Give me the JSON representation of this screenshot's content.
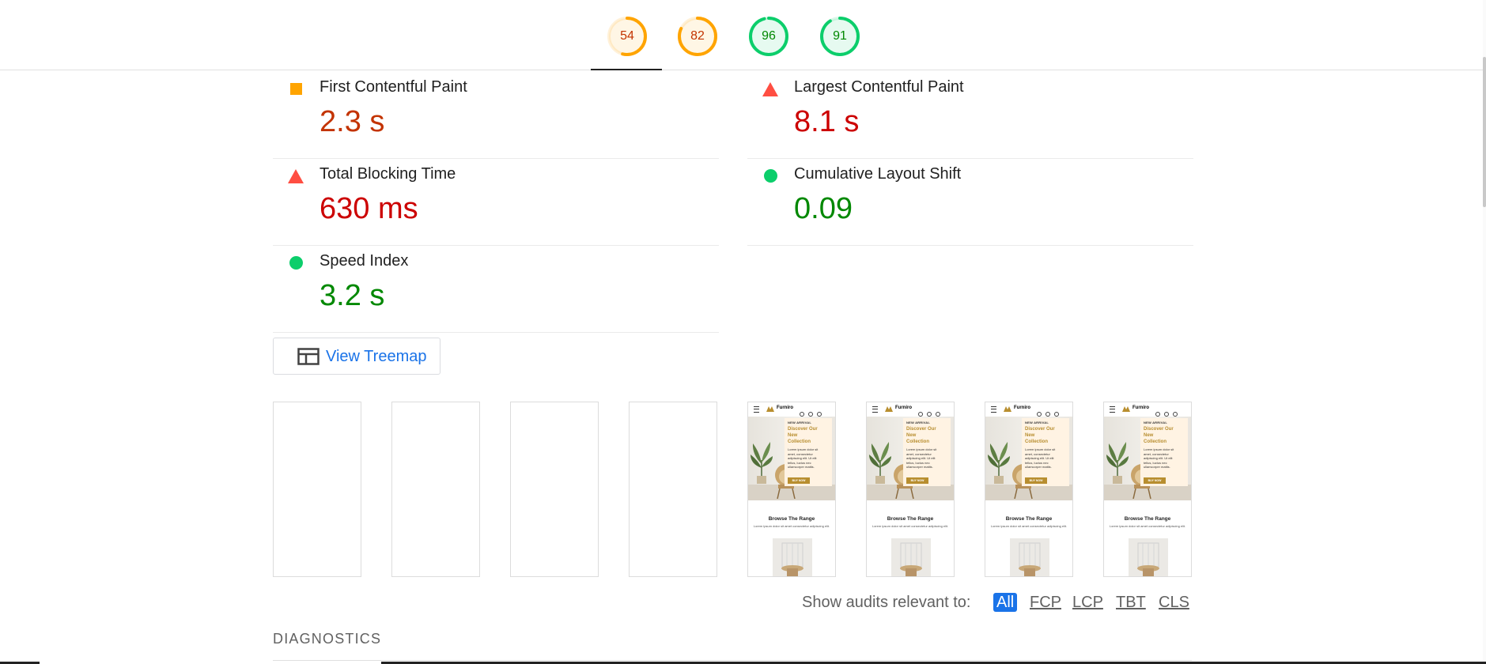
{
  "gauges": [
    {
      "score": "54",
      "fraction": 0.54,
      "color": "#ffa400",
      "text_color": "#c33300"
    },
    {
      "score": "82",
      "fraction": 0.82,
      "color": "#ffa400",
      "text_color": "#c33300"
    },
    {
      "score": "96",
      "fraction": 0.96,
      "color": "#0cce6b",
      "text_color": "#008800"
    },
    {
      "score": "91",
      "fraction": 0.91,
      "color": "#0cce6b",
      "text_color": "#008800"
    }
  ],
  "metrics": [
    {
      "title": "First Contentful Paint",
      "value": "2.3 s",
      "status": "average"
    },
    {
      "title": "Largest Contentful Paint",
      "value": "8.1 s",
      "status": "fail"
    },
    {
      "title": "Total Blocking Time",
      "value": "630 ms",
      "status": "fail"
    },
    {
      "title": "Cumulative Layout Shift",
      "value": "0.09",
      "status": "pass"
    },
    {
      "title": "Speed Index",
      "value": "3.2 s",
      "status": "pass"
    }
  ],
  "treemap": {
    "label": "View Treemap"
  },
  "filmstrip": {
    "brand": "Furniro",
    "new_arrival": "NEW ARRIVAL",
    "headline": "Discover Our New Collection",
    "body": "Lorem ipsum dolor sit amet, consectetur adipiscing elit. Ut elit tellus, luctus nec ullamcorper mattis.",
    "cta": "BUY NOW",
    "browse_title": "Browse The Range",
    "browse_sub": "Lorem ipsum dolor sit amet consectetur adipiscing elit."
  },
  "filters": {
    "label": "Show audits relevant to:",
    "chips": [
      "All",
      "FCP",
      "LCP",
      "TBT",
      "CLS"
    ]
  },
  "diagnostics": {
    "heading": "DIAGNOSTICS"
  },
  "colors": {
    "average": "#ffa400",
    "fail": "#ff4e42",
    "pass": "#0cce6b",
    "link": "#1a73e8"
  }
}
